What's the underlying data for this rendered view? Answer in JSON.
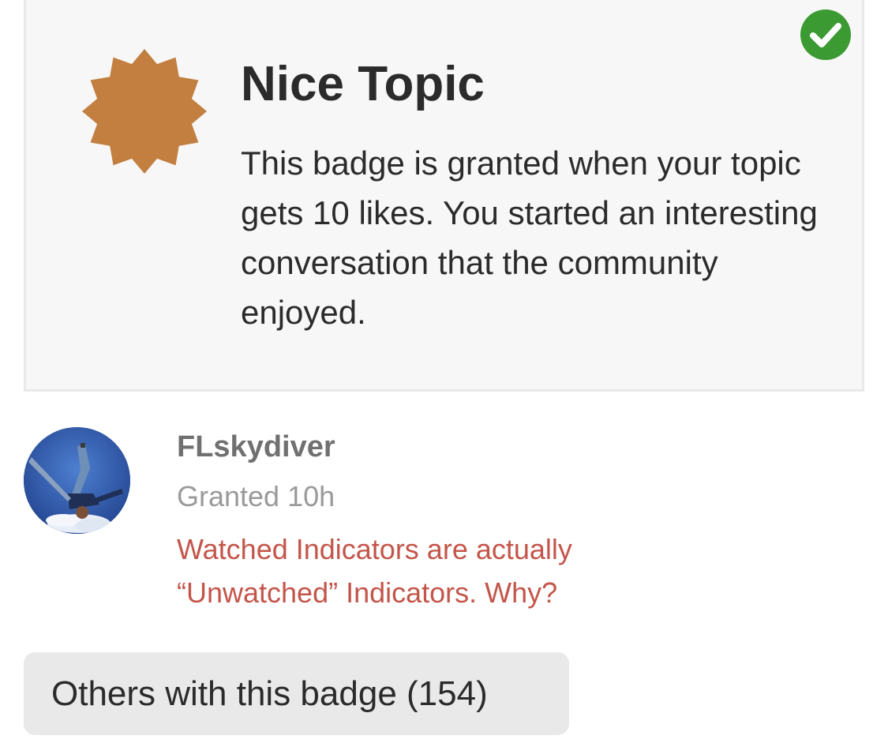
{
  "badge": {
    "title": "Nice Topic",
    "description": "This badge is granted when your topic gets 10 likes. You started an interesting conversation that the community enjoyed.",
    "icon": "badge-starburst-icon",
    "icon_color": "#c27f3f",
    "status_icon": "check-circle-icon",
    "status_color": "#3c9a32"
  },
  "grant": {
    "username": "FLskydiver",
    "granted": "Granted 10h",
    "topic_link": "Watched Indicators are actually “Unwatched” Indicators. Why?",
    "link_color": "#c4554a"
  },
  "others_button": {
    "label": "Others with this badge (154)"
  }
}
